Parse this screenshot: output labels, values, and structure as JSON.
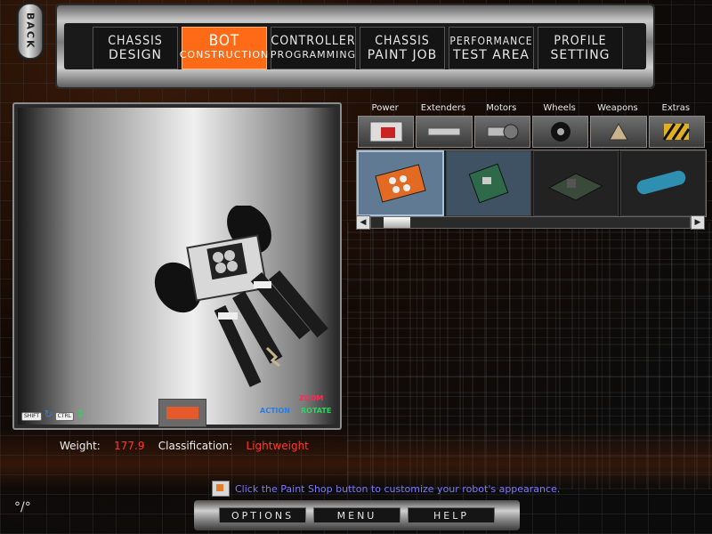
{
  "nav": {
    "back_label": "BACK",
    "tabs": [
      {
        "line1": "CHASSIS",
        "line2": "DESIGN",
        "active": false
      },
      {
        "line1": "BOT",
        "line2": "CONSTRUCTION",
        "active": true
      },
      {
        "line1": "CONTROLLER",
        "line2": "PROGRAMMING",
        "active": false
      },
      {
        "line1": "CHASSIS",
        "line2": "PAINT JOB",
        "active": false
      },
      {
        "line1": "PERFORMANCE",
        "line2": "TEST AREA",
        "active": false
      },
      {
        "line1": "PROFILE",
        "line2": "SETTING",
        "active": false
      }
    ]
  },
  "viewport": {
    "shift_key": "SHIFT",
    "ctrl_key": "CTRL",
    "action_label": "ACTION",
    "zoom_label": "ZOOM",
    "rotate_label": "ROTATE"
  },
  "parts": {
    "categories": [
      "Power",
      "Extenders",
      "Motors",
      "Wheels",
      "Weapons",
      "Extras"
    ],
    "items": [
      "battery-board-orange",
      "circuit-board-green",
      "circuit-board-dark",
      "blue-canister"
    ]
  },
  "stats": {
    "weight_label": "Weight:",
    "weight_value": "177.9",
    "class_label": "Classification:",
    "class_value": "Lightweight"
  },
  "hint": "Click the Paint Shop button to customize your robot's appearance.",
  "bottom": {
    "options": "OPTIONS",
    "menu": "MENU",
    "help": "HELP"
  },
  "colors": {
    "accent": "#ff6a16",
    "stat_value": "#ff3a2a",
    "hint_text": "#7d78ff"
  }
}
